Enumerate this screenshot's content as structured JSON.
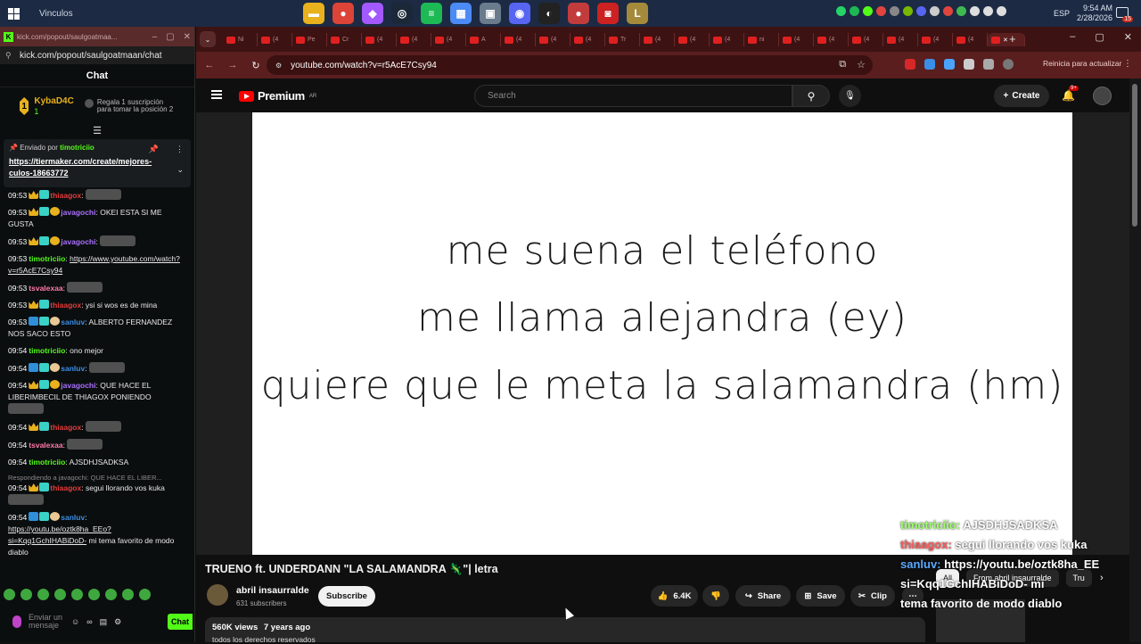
{
  "taskbar": {
    "label": "Vinculos",
    "lang": "ESP",
    "time": "9:54 AM",
    "date": "2/28/2026",
    "notif_count": "15",
    "apps": [
      {
        "name": "file-explorer-icon",
        "color": "#e8b11d",
        "glyph": "▬"
      },
      {
        "name": "chrome-icon",
        "color": "#db4437",
        "glyph": "●"
      },
      {
        "name": "figma-icon",
        "color": "#a259ff",
        "glyph": "◆"
      },
      {
        "name": "steam-icon",
        "color": "#1b2838",
        "glyph": "◎"
      },
      {
        "name": "spotify-icon",
        "color": "#1db954",
        "glyph": "≡"
      },
      {
        "name": "calendar-icon",
        "color": "#4c8bf5",
        "glyph": "▦"
      },
      {
        "name": "gallery-icon",
        "color": "#6a7b8c",
        "glyph": "▣"
      },
      {
        "name": "discord-icon",
        "color": "#5865f2",
        "glyph": "◉"
      },
      {
        "name": "obs-icon",
        "color": "#222222",
        "glyph": "◐"
      },
      {
        "name": "chrome-alt-icon",
        "color": "#c23c3c",
        "glyph": "●"
      },
      {
        "name": "app-red-icon",
        "color": "#cc2222",
        "glyph": "◙"
      },
      {
        "name": "league-icon",
        "color": "#a58a3c",
        "glyph": "L"
      }
    ]
  },
  "kick": {
    "title": "kick.com/popout/saulgoatmaa...",
    "url": "kick.com/popout/saulgoatmaan/chat",
    "header": "Chat",
    "leader": {
      "rank": "1",
      "name": "KybaD4C",
      "count": "1",
      "gift_text": "Regala 1 suscripción para tomar la posición 2"
    },
    "pinned": {
      "by_label": "Enviado por",
      "by_user": "timotriciio",
      "link": "https://tiermaker.com/create/mejores-culos-18663772"
    },
    "messages": [
      {
        "time": "09:53",
        "badges": [
          "crown",
          "sub"
        ],
        "user": "thiaagox",
        "color": "#e63b3b",
        "text": "",
        "emote": true
      },
      {
        "time": "09:53",
        "badges": [
          "crown",
          "sub",
          "gift"
        ],
        "user": "javagochi",
        "color": "#a970ff",
        "text": "OKEI ESTA SI ME GUSTA",
        "emote": false
      },
      {
        "time": "09:53",
        "badges": [
          "crown",
          "sub",
          "gift"
        ],
        "user": "javagochi",
        "color": "#a970ff",
        "text": "",
        "emote": true
      },
      {
        "time": "09:53",
        "badges": [],
        "user": "timotriciio",
        "color": "#53fc18",
        "text": "https://www.youtube.com/watch?v=r5AcE7Csy94",
        "link": true,
        "emote": false
      },
      {
        "time": "09:53",
        "badges": [],
        "user": "tsvalexaa",
        "color": "#ff7aa8",
        "text": "",
        "emote": true
      },
      {
        "time": "09:53",
        "badges": [
          "crown",
          "sub"
        ],
        "user": "thiaagox",
        "color": "#e63b3b",
        "text": "ysi si wos es de mina",
        "emote": false
      },
      {
        "time": "09:53",
        "badges": [
          "vip",
          "sub",
          "hand"
        ],
        "user": "sanluv",
        "color": "#3a8ee6",
        "text": "ALBERTO FERNANDEZ NOS SACO ESTO",
        "emote": false
      },
      {
        "time": "09:54",
        "badges": [],
        "user": "timotriciio",
        "color": "#53fc18",
        "text": "ono mejor",
        "emote": false
      },
      {
        "time": "09:54",
        "badges": [
          "vip",
          "sub",
          "hand"
        ],
        "user": "sanluv",
        "color": "#3a8ee6",
        "text": "",
        "emote": true
      },
      {
        "time": "09:54",
        "badges": [
          "crown",
          "sub",
          "gift"
        ],
        "user": "javagochi",
        "color": "#a970ff",
        "text": "QUE HACE EL LIBERIMBECIL DE THIAGOX PONIENDO",
        "emote": true
      },
      {
        "time": "09:54",
        "badges": [
          "crown",
          "sub"
        ],
        "user": "thiaagox",
        "color": "#e63b3b",
        "text": "",
        "emote": true
      },
      {
        "time": "09:54",
        "badges": [],
        "user": "tsvalexaa",
        "color": "#ff7aa8",
        "text": "",
        "emote": true
      },
      {
        "time": "09:54",
        "badges": [],
        "user": "timotriciio",
        "color": "#53fc18",
        "text": "AJSDHJSADKSA",
        "emote": false
      },
      {
        "reply": "Respondiendo a javagochi: QUE HACE EL LIBER...",
        "time": "09:54",
        "badges": [
          "crown",
          "sub"
        ],
        "user": "thiaagox",
        "color": "#e63b3b",
        "text": "segui llorando vos kuka",
        "emote": true
      },
      {
        "time": "09:54",
        "badges": [
          "vip",
          "sub",
          "hand"
        ],
        "user": "sanluv",
        "color": "#3a8ee6",
        "text": "https://youtu.be/oztk8ha_EEo?si=Kqq1GchIHABiDoD-",
        "link": true,
        "after": " mi tema favorito de modo diablo",
        "emote": false
      }
    ],
    "input_placeholder": "Enviar un mensaje",
    "send_label": "Chat"
  },
  "chrome": {
    "url": "youtube.com/watch?v=r5AcE7Csy94",
    "restart_label": "Reinicia para actualizar",
    "tabs": [
      "Ni",
      "(4",
      "Pe",
      "Cr",
      "(4",
      "(4",
      "(4",
      "A",
      "(4",
      "(4",
      "(4",
      "Tr",
      "(4",
      "(4",
      "(4",
      "ni",
      "(4",
      "(4",
      "(4",
      "(4",
      "(4",
      "(4"
    ]
  },
  "youtube": {
    "brand": "Premium",
    "region": "AR",
    "search_placeholder": "Search",
    "create_label": "Create",
    "notif_count": "9+",
    "lyrics": [
      "me suena el teléfono",
      "me llama alejandra (ey)",
      "quiere que le meta la salamandra (hm)"
    ],
    "overlay": [
      {
        "user": "timotriciio:",
        "color": "#9cff6b",
        "text": "AJSDHJSADKSA"
      },
      {
        "user": "thiaagox:",
        "color": "#ff5c5c",
        "text": "segui llorando vos kuka"
      },
      {
        "user": "sanluv:",
        "color": "#5aa8ff",
        "text": "https://youtu.be/oztk8ha_EE"
      },
      {
        "user": "",
        "color": "#fff",
        "text": "si=Kqq1GchIHABiDoD- mi"
      },
      {
        "user": "",
        "color": "#fff",
        "text": "tema favorito de modo diablo"
      }
    ],
    "title": "TRUENO ft. UNDERDANN \"LA SALAMANDRA 🦎\"| letra",
    "channel": "abril insaurralde",
    "subscribers": "631 subscribers",
    "subscribe_label": "Subscribe",
    "likes": "6.4K",
    "share_label": "Share",
    "save_label": "Save",
    "clip_label": "Clip",
    "views": "560K views",
    "age": "7 years ago",
    "desc_line": "todos los derechos reservados",
    "chips": [
      "All",
      "From abril insaurralde",
      "Tru"
    ]
  }
}
